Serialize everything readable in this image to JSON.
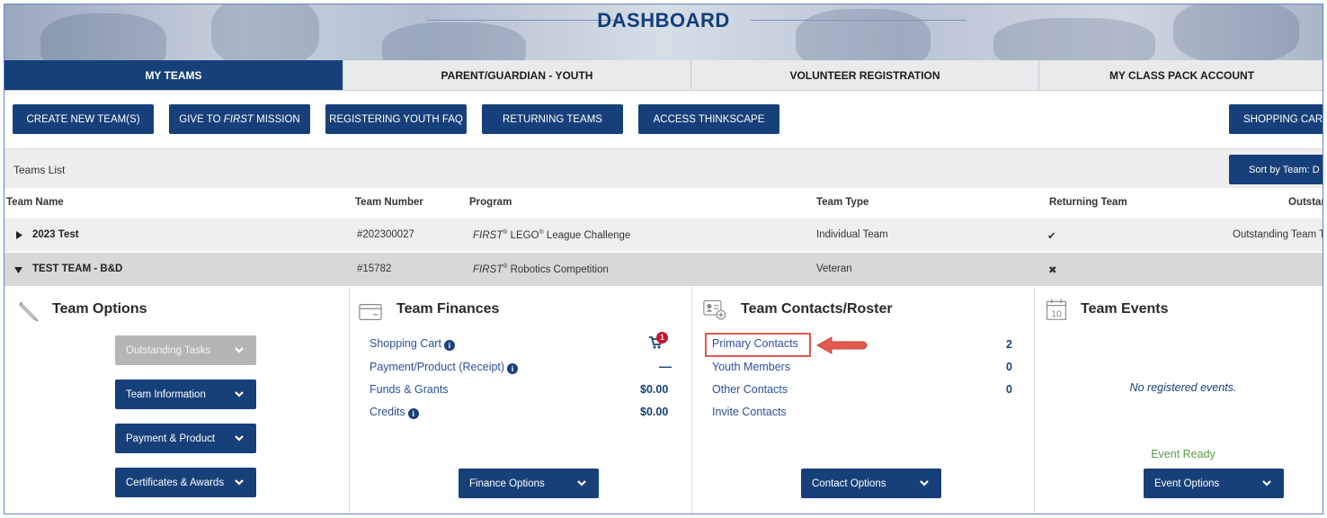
{
  "hero": {
    "title": "DASHBOARD"
  },
  "tabs": [
    {
      "label": "MY TEAMS",
      "active": true
    },
    {
      "label": "PARENT/GUARDIAN - YOUTH",
      "active": false
    },
    {
      "label": "VOLUNTEER REGISTRATION",
      "active": false
    },
    {
      "label": "MY CLASS PACK ACCOUNT",
      "active": false
    }
  ],
  "actions": {
    "create_new_team": "CREATE NEW TEAM(S)",
    "give_to_first_prefix": "GIVE TO ",
    "give_to_first_italic": "FIRST",
    "give_to_first_suffix": " MISSION",
    "registering_youth_faq": "REGISTERING YOUTH FAQ",
    "returning_teams": "RETURNING TEAMS",
    "access_thinkscape": "ACCESS THINKSCAPE",
    "shopping_cart": "SHOPPING CART"
  },
  "teams_list": {
    "title": "Teams List",
    "sort_label": "Sort by Team: D",
    "columns": [
      "Team Name",
      "Team Number",
      "Program",
      "Team Type",
      "Returning Team",
      "Outstan"
    ],
    "rows": [
      {
        "name": "2023 Test",
        "number": "#202300027",
        "program_brand": "FIRST",
        "program_mid": " LEGO",
        "program_rest": " League Challenge",
        "type": "Individual Team",
        "returning": "✔",
        "outstanding": "Outstanding Team Ta",
        "expanded": false
      },
      {
        "name": "TEST TEAM - B&D",
        "number": "#15782",
        "program_brand": "FIRST",
        "program_mid": "",
        "program_rest": " Robotics Competition",
        "type": "Veteran",
        "returning": "✖",
        "outstanding": "",
        "expanded": true
      }
    ],
    "registered_mark": "®"
  },
  "team_options": {
    "title": "Team Options",
    "icon": "pencil-icon",
    "buttons": [
      "Outstanding Tasks",
      "Team Information",
      "Payment & Product",
      "Certificates & Awards"
    ]
  },
  "team_finances": {
    "title": "Team Finances",
    "icon": "credit-card-icon",
    "items": [
      {
        "label": "Shopping Cart",
        "info": true,
        "value": ""
      },
      {
        "label": "Payment/Product (Receipt)",
        "info": true,
        "value": "—"
      },
      {
        "label": "Funds & Grants",
        "info": false,
        "value": "$0.00"
      },
      {
        "label": "Credits",
        "info": true,
        "value": "$0.00"
      }
    ],
    "cart_badge": "1",
    "options_button": "Finance Options"
  },
  "team_contacts": {
    "title": "Team Contacts/Roster",
    "icon": "contact-card-icon",
    "items": [
      {
        "label": "Primary Contacts",
        "value": "2"
      },
      {
        "label": "Youth Members",
        "value": "0"
      },
      {
        "label": "Other Contacts",
        "value": "0"
      },
      {
        "label": "Invite Contacts",
        "value": ""
      }
    ],
    "options_button": "Contact Options"
  },
  "team_events": {
    "title": "Team Events",
    "icon": "calendar-icon",
    "calendar_day": "10",
    "empty_text": "No registered events.",
    "status": "Event Ready",
    "options_button": "Event Options"
  },
  "colors": {
    "primary": "#17407a",
    "link": "#2d4f9e",
    "highlight": "#e05a4f",
    "success": "#5a9a4a"
  }
}
